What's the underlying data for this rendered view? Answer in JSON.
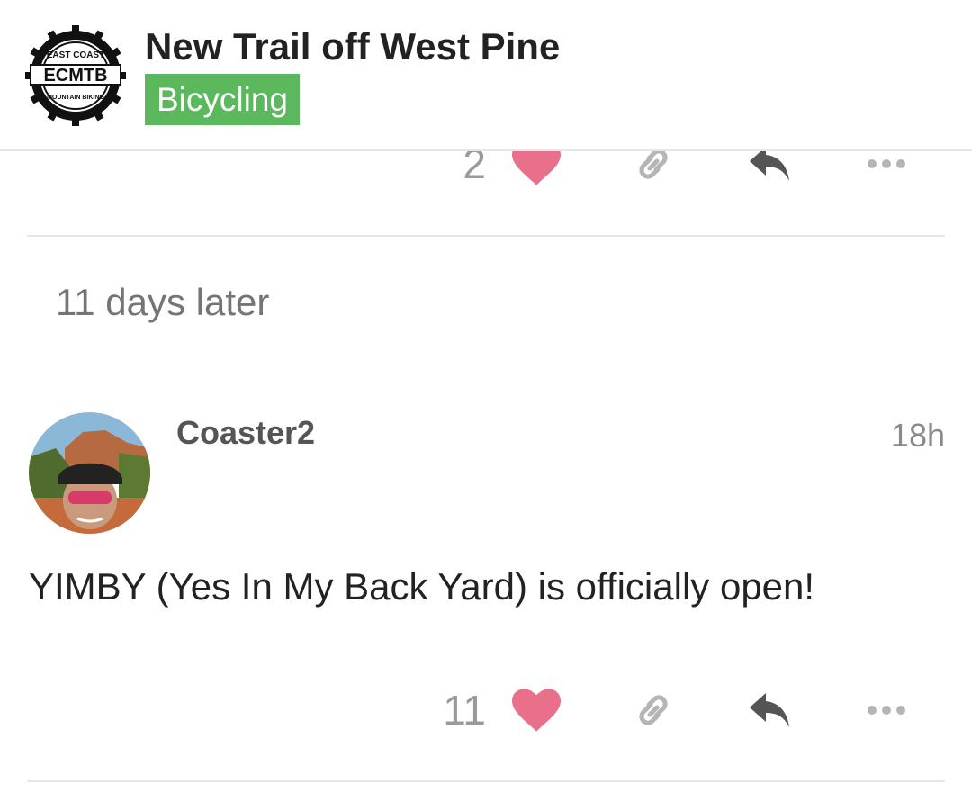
{
  "header": {
    "logo_text": {
      "top": "EAST COAST",
      "middle": "ECMTB",
      "bottom": "MOUNTAIN BIKING"
    },
    "title": "New Trail off West Pine",
    "category": "Bicycling",
    "category_color": "#5cb85c"
  },
  "previous_post": {
    "like_count": "2"
  },
  "time_gap": "11 days later",
  "post": {
    "username": "Coaster2",
    "date": "18h",
    "body": "YIMBY (Yes In My Back Yard) is officially open!",
    "like_count": "11"
  },
  "icons": {
    "like": "heart-icon",
    "link": "link-icon",
    "reply": "reply-icon",
    "more": "more-icon",
    "like_color": "#e9708a"
  }
}
